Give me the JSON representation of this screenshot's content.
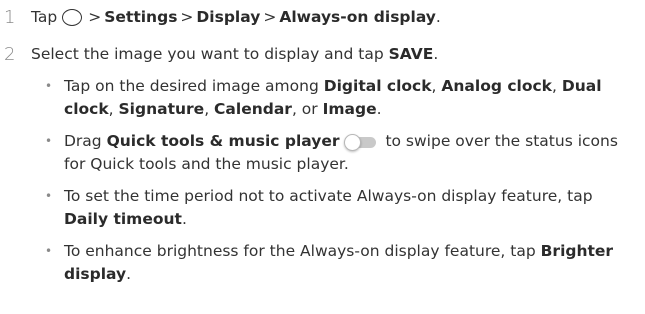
{
  "step1": {
    "number": "1",
    "tap": "Tap",
    "icon": "home-circle-icon",
    "sep": ">",
    "settings": "Settings",
    "display": "Display",
    "aod": "Always-on display",
    "period": "."
  },
  "step2": {
    "number": "2",
    "text_a": "Select the image you want to display and tap ",
    "save": "SAVE",
    "period": ".",
    "bullets": {
      "b1": {
        "text_a": "Tap on the desired image among ",
        "digital": "Digital clock",
        "comma1": ", ",
        "analog": "Analog clock",
        "comma2": ", ",
        "dual": "Dual clock",
        "comma3": ", ",
        "signature": "Signature",
        "comma4": ", ",
        "calendar": "Calendar",
        "or": ", or ",
        "image": "Image",
        "period": "."
      },
      "b2": {
        "text_a": "Drag ",
        "quick": "Quick tools & music player",
        "icon": "toggle-switch-icon",
        "text_b": " to swipe over the status icons for Quick tools and the music player."
      },
      "b3": {
        "text_a": "To set the time period not to activate Always-on display feature, tap ",
        "daily": "Daily timeout",
        "period": "."
      },
      "b4": {
        "text_a": "To enhance brightness for the Always-on display feature, tap ",
        "brighter": "Brighter display",
        "period": "."
      }
    }
  }
}
